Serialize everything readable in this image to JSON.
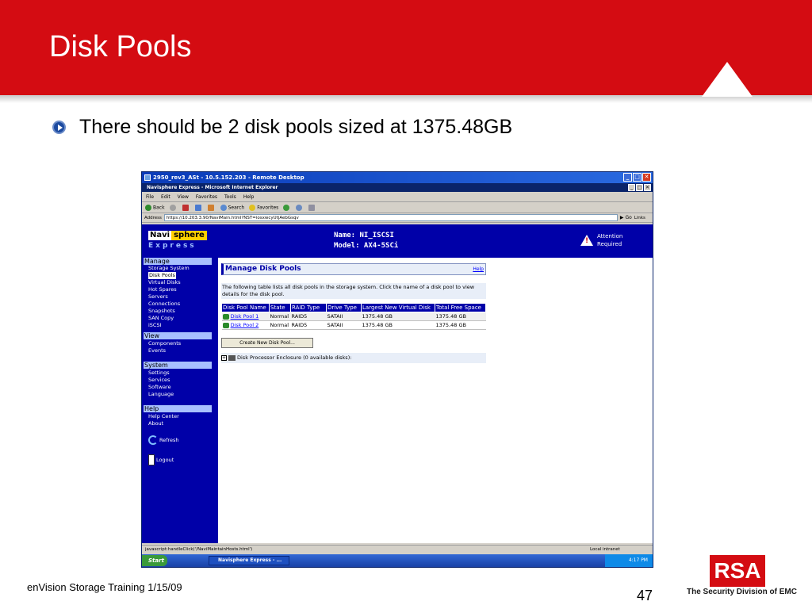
{
  "slide": {
    "title": "Disk Pools",
    "bullet": "There should be 2 disk pools sized at 1375.48GB",
    "footer": "enVision Storage Training 1/15/09",
    "page_number": "47",
    "logo_text": "RSA",
    "logo_tagline": "The Security Division of EMC",
    "brand_color": "#d40c12"
  },
  "window": {
    "rd_title": "2950_rev3_ASt - 10.5.152.203 - Remote Desktop",
    "ie_title": "Navisphere Express - Microsoft Internet Explorer",
    "menu": [
      "File",
      "Edit",
      "View",
      "Favorites",
      "Tools",
      "Help"
    ],
    "toolbar": {
      "back": "Back",
      "search": "Search",
      "favorites": "Favorites"
    },
    "address_label": "Address",
    "address_value": "https://10.203.3.90/NaviMain.html?NST=iosxwcyUtjAebGsqv",
    "go_label": "Go",
    "links_label": "Links"
  },
  "app": {
    "logo_navi": "Navi",
    "logo_sphere": "sphere",
    "logo_express": "Express",
    "name_line": "Name: NI_ISCSI",
    "model_line": "Model: AX4-5SCi",
    "attention": "Attention",
    "required": "Required"
  },
  "sidebar": {
    "manage_head": "Manage",
    "manage_items": [
      "Storage System",
      "Disk Pools",
      "Virtual Disks",
      "Hot Spares",
      "Servers",
      "Connections",
      "Snapshots",
      "SAN Copy",
      "iSCSI"
    ],
    "view_head": "View",
    "view_items": [
      "Components",
      "Events"
    ],
    "system_head": "System",
    "system_items": [
      "Settings",
      "Services",
      "Software",
      "Language"
    ],
    "help_head": "Help",
    "help_items": [
      "Help Center",
      "About"
    ],
    "refresh": "Refresh",
    "logout": "Logout"
  },
  "main": {
    "title": "Manage Disk Pools",
    "help": "Help",
    "description": "The following table lists all disk pools in the storage system. Click the name of a disk pool to view details for the disk pool.",
    "columns": [
      "Disk Pool Name",
      "State",
      "RAID Type",
      "Drive Type",
      "Largest New Virtual Disk",
      "Total Free Space"
    ],
    "rows": [
      [
        "Disk Pool 1",
        "Normal",
        "RAID5",
        "SATAII",
        "1375.48 GB",
        "1375.48 GB"
      ],
      [
        "Disk Pool 2",
        "Normal",
        "RAID5",
        "SATAII",
        "1375.48 GB",
        "1375.48 GB"
      ]
    ],
    "create_button": "Create New Disk Pool...",
    "enclosure": "Disk Processor Enclosure (0 available disks):"
  },
  "status": {
    "text": "javascript:handleClick('/NaviMaintainHosts.html')",
    "zone": "Local intranet"
  },
  "taskbar": {
    "start": "Start",
    "task": "Navisphere Express - ...",
    "clock": "4:17 PM"
  }
}
